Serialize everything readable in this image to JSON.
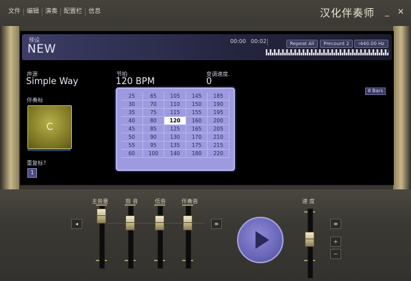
{
  "menu": [
    "文件",
    "编辑",
    "演奏",
    "配置栏",
    "信息"
  ],
  "app_title": "汉化伴奏师",
  "window_controls": {
    "minimize_icon": "minimize-icon",
    "close_icon": "close-icon",
    "minimize": "_",
    "close": "✕"
  },
  "header": {
    "preset_label": "预设",
    "preset_value": "NEW",
    "time_elapsed": "00:00",
    "time_total": "00:02",
    "repeat_button": "Repeat All",
    "precount_button": "Precount 2",
    "tuning_button": "♮440.00 Hz"
  },
  "style": {
    "label": "声源",
    "value": "Simple Way"
  },
  "tempo": {
    "label": "节拍",
    "value": "120 BPM"
  },
  "tempo_change": {
    "label": "变调速度.",
    "value": "0"
  },
  "bars_button": "8 Bars",
  "accomp": {
    "label": "伴奏标",
    "chord": "C"
  },
  "repeat": {
    "label": "重复标?",
    "value": "1"
  },
  "tempo_grid": {
    "selected": "120",
    "rows": [
      [
        "25",
        "65",
        "105",
        "145",
        "185"
      ],
      [
        "30",
        "70",
        "110",
        "150",
        "190"
      ],
      [
        "35",
        "75",
        "115",
        "155",
        "195"
      ],
      [
        "40",
        "80",
        "120",
        "160",
        "200"
      ],
      [
        "45",
        "85",
        "125",
        "165",
        "205"
      ],
      [
        "50",
        "90",
        "130",
        "170",
        "210"
      ],
      [
        "55",
        "95",
        "135",
        "175",
        "215"
      ],
      [
        "60",
        "100",
        "140",
        "180",
        "220"
      ]
    ]
  },
  "mixer": {
    "channels": [
      {
        "label": "主音量"
      },
      {
        "label": "鼓 音"
      },
      {
        "label": "低音"
      },
      {
        "label": "伴奏音"
      },
      {
        "label": "速 度"
      }
    ],
    "plus": "+",
    "minus": "−"
  },
  "colors": {
    "accent": "#7d79d0",
    "pad": "#9c9436",
    "screen": "#000000"
  }
}
